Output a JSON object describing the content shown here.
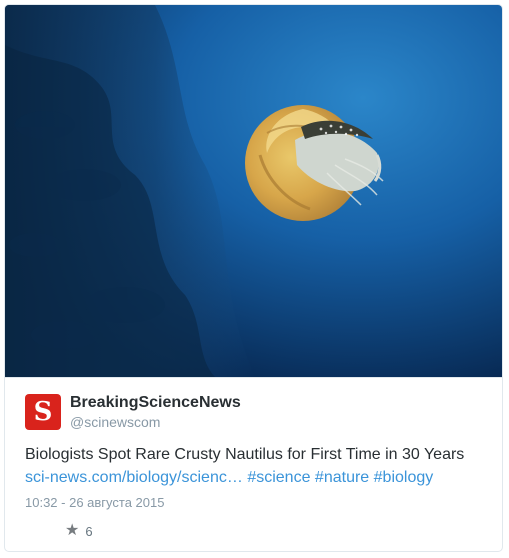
{
  "author": {
    "display_name": "BreakingScienceNews",
    "handle": "@scinewscom",
    "avatar_icon": "sci-news-logo-icon",
    "avatar_glyph": "S",
    "avatar_color": "#d9231c"
  },
  "tweet": {
    "text": "Biologists Spot Rare Crusty Nautilus for First Time in 30 Years",
    "link": "sci-news.com/biology/scienc…",
    "hashtags": [
      "#science",
      "#nature",
      "#biology"
    ]
  },
  "timestamp": "10:32 - 26 августа 2015",
  "actions": {
    "favorite_icon": "star-icon",
    "favorite_count": "6"
  },
  "colors": {
    "link": "#3b94d9",
    "text": "#292f33",
    "muted": "#8899a6",
    "water_deep": "#06234a",
    "water_light": "#2b86c9"
  }
}
